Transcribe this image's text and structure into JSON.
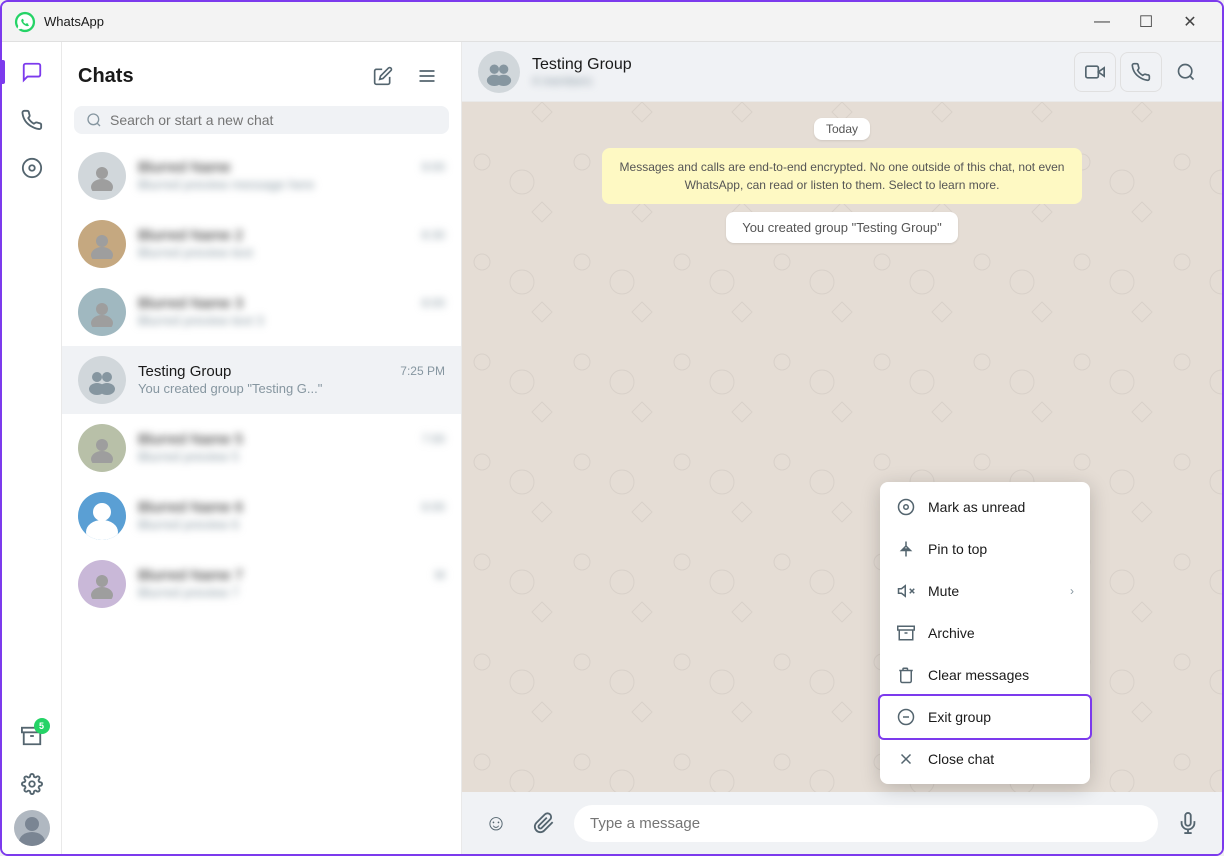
{
  "window": {
    "title": "WhatsApp",
    "controls": {
      "minimize": "—",
      "maximize": "☐",
      "close": "✕"
    }
  },
  "nav": {
    "icons": [
      {
        "name": "chats-icon",
        "symbol": "💬",
        "active": true,
        "badge": null
      },
      {
        "name": "calls-icon",
        "symbol": "📞",
        "active": false,
        "badge": null
      },
      {
        "name": "status-icon",
        "symbol": "⊙",
        "active": false,
        "badge": null
      },
      {
        "name": "archive-icon",
        "symbol": "⊡",
        "active": false,
        "badge": "5"
      },
      {
        "name": "settings-icon",
        "symbol": "⚙",
        "active": false,
        "badge": null
      }
    ]
  },
  "chat_list": {
    "title": "Chats",
    "compose_label": "Compose",
    "filter_label": "Filter",
    "search_placeholder": "Search or start a new chat",
    "items": [
      {
        "id": 1,
        "name": "BLURRED_1",
        "preview": "BLURRED_PREVIEW",
        "time": "BLURRED",
        "blurred": true
      },
      {
        "id": 2,
        "name": "BLURRED_2",
        "preview": "BLURRED_PREVIEW",
        "time": "BLURRED",
        "blurred": true
      },
      {
        "id": 3,
        "name": "BLURRED_3",
        "preview": "BLURRED_PREVIEW",
        "time": "BLURRED",
        "blurred": true
      },
      {
        "id": 4,
        "name": "Testing Group",
        "preview": "You created group \"Testing G...\"",
        "time": "7:25 PM",
        "blurred": false,
        "active": true,
        "isGroup": true
      },
      {
        "id": 5,
        "name": "BLURRED_5",
        "preview": "BLURRED_PREVIEW",
        "time": "BLURRED",
        "blurred": true
      },
      {
        "id": 6,
        "name": "BLURRED_6",
        "preview": "BLURRED_PREVIEW",
        "time": "BLURRED",
        "blurred": true
      },
      {
        "id": 7,
        "name": "BLURRED_7",
        "preview": "BLURRED_PREVIEW",
        "time": "M",
        "blurred": true
      }
    ]
  },
  "chat": {
    "name": "Testing Group",
    "status": "4 members",
    "date_divider": "Today",
    "encryption_notice": "Messages and calls are end-to-end encrypted. No one outside of this chat, not even WhatsApp, can read or listen to them. Select to learn more.",
    "system_message": "You created group \"Testing Group\"",
    "input_placeholder": "Type a message",
    "actions": {
      "video": "📹",
      "call": "📞",
      "search": "🔍"
    }
  },
  "context_menu": {
    "items": [
      {
        "id": "mark-unread",
        "label": "Mark as unread",
        "icon": "mark-icon",
        "icon_symbol": "◎",
        "has_arrow": false,
        "highlighted": false
      },
      {
        "id": "pin-to-top",
        "label": "Pin to top",
        "icon": "pin-icon",
        "icon_symbol": "📌",
        "has_arrow": false,
        "highlighted": false
      },
      {
        "id": "mute",
        "label": "Mute",
        "icon": "mute-icon",
        "icon_symbol": "🔇",
        "has_arrow": true,
        "highlighted": false
      },
      {
        "id": "archive",
        "label": "Archive",
        "icon": "archive-icon",
        "icon_symbol": "📦",
        "has_arrow": false,
        "highlighted": false
      },
      {
        "id": "clear-messages",
        "label": "Clear messages",
        "icon": "clear-icon",
        "icon_symbol": "🗑",
        "has_arrow": false,
        "highlighted": false
      },
      {
        "id": "exit-group",
        "label": "Exit group",
        "icon": "exit-icon",
        "icon_symbol": "⊖",
        "has_arrow": false,
        "highlighted": true
      },
      {
        "id": "close-chat",
        "label": "Close chat",
        "icon": "close-chat-icon",
        "icon_symbol": "✕",
        "has_arrow": false,
        "highlighted": false
      }
    ]
  }
}
